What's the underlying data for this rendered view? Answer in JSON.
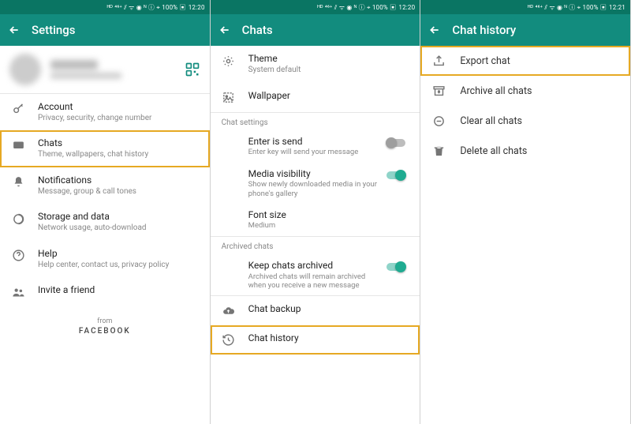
{
  "status": {
    "icons": "ᴴᴰ ⁴⁶⁺ ⫽ ᯤ ◉ ᴺ ⓘ ⌖ 100% ▣",
    "time1": "12:20",
    "time2": "12:21"
  },
  "screen1": {
    "title": "Settings",
    "items": [
      {
        "label": "Account",
        "sub": "Privacy, security, change number"
      },
      {
        "label": "Chats",
        "sub": "Theme, wallpapers, chat history"
      },
      {
        "label": "Notifications",
        "sub": "Message, group & call tones"
      },
      {
        "label": "Storage and data",
        "sub": "Network usage, auto-download"
      },
      {
        "label": "Help",
        "sub": "Help center, contact us, privacy policy"
      },
      {
        "label": "Invite a friend",
        "sub": ""
      }
    ],
    "from": "from",
    "facebook": "FACEBOOK"
  },
  "screen2": {
    "title": "Chats",
    "theme": {
      "label": "Theme",
      "sub": "System default"
    },
    "wallpaper": {
      "label": "Wallpaper"
    },
    "section_settings": "Chat settings",
    "enter": {
      "label": "Enter is send",
      "sub": "Enter key will send your message"
    },
    "media": {
      "label": "Media visibility",
      "sub": "Show newly downloaded media in your phone's gallery"
    },
    "font": {
      "label": "Font size",
      "sub": "Medium"
    },
    "section_archived": "Archived chats",
    "keep": {
      "label": "Keep chats archived",
      "sub": "Archived chats will remain archived when you receive a new message"
    },
    "backup": {
      "label": "Chat backup"
    },
    "history": {
      "label": "Chat history"
    }
  },
  "screen3": {
    "title": "Chat history",
    "items": [
      {
        "label": "Export chat"
      },
      {
        "label": "Archive all chats"
      },
      {
        "label": "Clear all chats"
      },
      {
        "label": "Delete all chats"
      }
    ]
  }
}
